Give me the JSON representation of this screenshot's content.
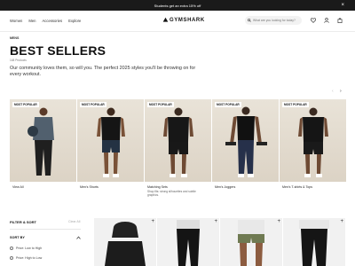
{
  "promo": {
    "text": "Students get an extra 15% off",
    "close_icon": "close-icon"
  },
  "header": {
    "nav": [
      "Women",
      "Men",
      "Accessories",
      "Explore"
    ],
    "logo": "GYMSHARK",
    "search_placeholder": "What are you looking for today?",
    "icons": [
      "search-icon",
      "heart-icon",
      "user-icon",
      "bag-icon"
    ]
  },
  "page": {
    "breadcrumb": "MENS",
    "title": "BEST SELLERS",
    "count": "148 Products",
    "description": "Our community loves them, so will you. The perfect 2025 styles you'll be throwing on for every workout."
  },
  "carousel": {
    "prev": "‹",
    "next": "›"
  },
  "cards": [
    {
      "badge": "MOST POPULAR",
      "label": "View All",
      "sub": ""
    },
    {
      "badge": "MOST POPULAR",
      "label": "Men's Shorts",
      "sub": ""
    },
    {
      "badge": "MOST POPULAR",
      "label": "Matching Sets",
      "sub": "Shop fits: strong silhouettes and subtle graphics."
    },
    {
      "badge": "MOST POPULAR",
      "label": "Men's Joggers",
      "sub": ""
    },
    {
      "badge": "MOST POPULAR",
      "label": "Men's T-shirts & Tops",
      "sub": ""
    }
  ],
  "filter": {
    "title": "FILTER & SORT",
    "clear": "Clear All",
    "sort_title": "SORT BY",
    "options": [
      "Price: Low to High",
      "Price: High to Low"
    ]
  },
  "grid": {
    "plus": "+"
  }
}
